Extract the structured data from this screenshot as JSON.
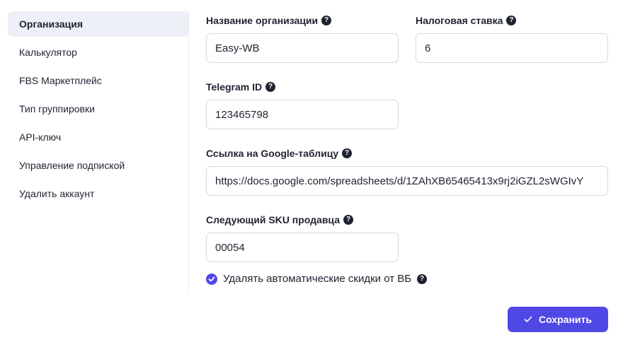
{
  "sidebar": {
    "items": [
      {
        "label": "Организация"
      },
      {
        "label": "Калькулятор"
      },
      {
        "label": "FBS Маркетплейс"
      },
      {
        "label": "Тип группировки"
      },
      {
        "label": "API-ключ"
      },
      {
        "label": "Управление подпиской"
      },
      {
        "label": "Удалить аккаунт"
      }
    ]
  },
  "form": {
    "org_name": {
      "label": "Название организации",
      "value": "Easy-WB"
    },
    "tax_rate": {
      "label": "Налоговая ставка",
      "value": "6"
    },
    "telegram": {
      "label": "Telegram ID",
      "value": "123465798"
    },
    "google_sheet": {
      "label": "Ссылка на Google-таблицу",
      "value": "https://docs.google.com/spreadsheets/d/1ZAhXB65465413x9rj2iGZL2sWGIvY"
    },
    "next_sku": {
      "label": "Следующий SKU продавца",
      "value": "00054"
    },
    "remove_discounts": {
      "label": "Удалять автоматические скидки от ВБ",
      "checked": true
    }
  },
  "help_glyph": "?",
  "save_label": "Сохранить",
  "colors": {
    "accent": "#5048e5",
    "active_bg": "#eef0f7",
    "border": "#d5d8e0"
  }
}
